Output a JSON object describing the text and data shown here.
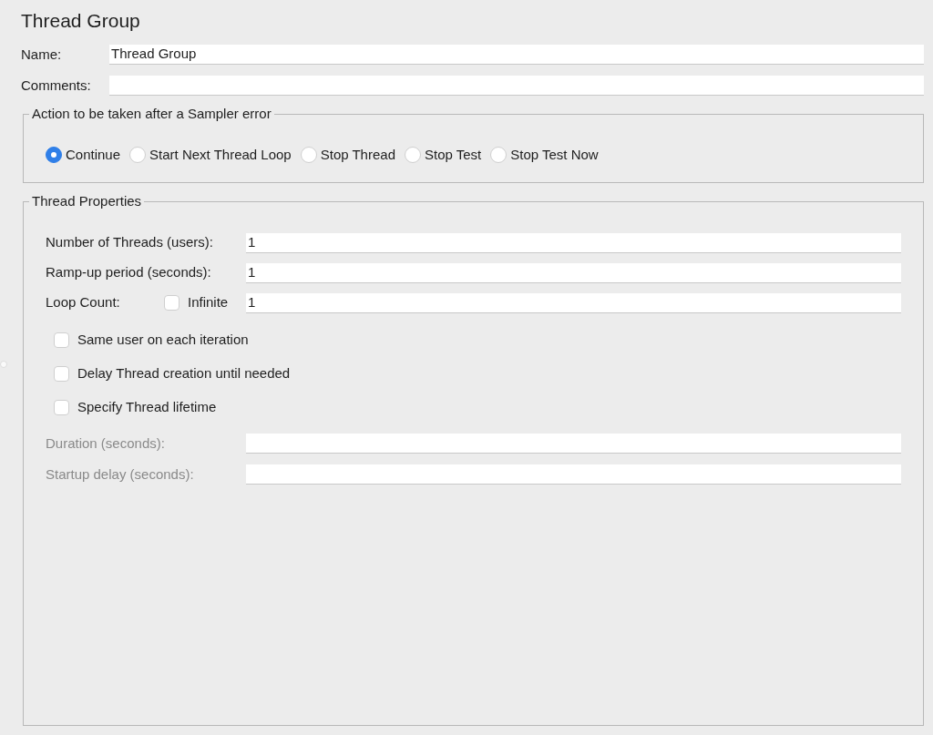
{
  "title": "Thread Group",
  "name_field": {
    "label": "Name:",
    "value": "Thread Group"
  },
  "comments_field": {
    "label": "Comments:"
  },
  "sampler_error": {
    "legend": "Action to be taken after a Sampler error",
    "options": [
      {
        "label": "Continue",
        "selected": true
      },
      {
        "label": "Start Next Thread Loop",
        "selected": false
      },
      {
        "label": "Stop Thread",
        "selected": false
      },
      {
        "label": "Stop Test",
        "selected": false
      },
      {
        "label": "Stop Test Now",
        "selected": false
      }
    ]
  },
  "thread_properties": {
    "legend": "Thread Properties",
    "fields": [
      {
        "label": "Number of Threads (users):",
        "value": "1",
        "disabled": false
      },
      {
        "label": "Ramp-up period (seconds):",
        "value": "1",
        "disabled": false
      }
    ],
    "loop_count": {
      "label": "Loop Count:",
      "infinite_label": "Infinite",
      "infinite_checked": false,
      "value": "1"
    },
    "options": [
      {
        "label": "Same user on each iteration",
        "checked": false
      },
      {
        "label": "Delay Thread creation until needed",
        "checked": false
      },
      {
        "label": "Specify Thread lifetime",
        "checked": false
      }
    ],
    "lifetime_fields": [
      {
        "label": "Duration (seconds):",
        "disabled": true
      },
      {
        "label": "Startup delay (seconds):",
        "disabled": true
      }
    ]
  }
}
